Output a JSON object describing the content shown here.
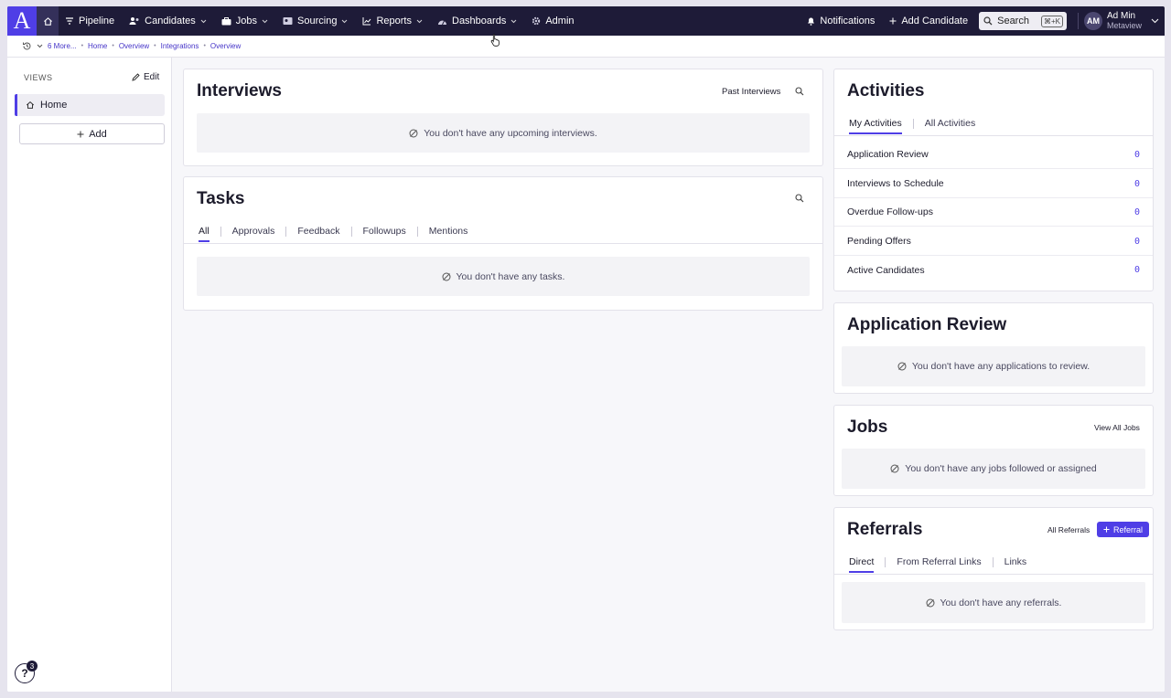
{
  "nav": {
    "logo_letter": "A",
    "items": [
      {
        "label": "Pipeline",
        "icon": "filter-icon",
        "dropdown": false
      },
      {
        "label": "Candidates",
        "icon": "people-icon",
        "dropdown": true
      },
      {
        "label": "Jobs",
        "icon": "briefcase-icon",
        "dropdown": true
      },
      {
        "label": "Sourcing",
        "icon": "sourcing-icon",
        "dropdown": true
      },
      {
        "label": "Reports",
        "icon": "chart-icon",
        "dropdown": true
      },
      {
        "label": "Dashboards",
        "icon": "gauge-icon",
        "dropdown": true
      },
      {
        "label": "Admin",
        "icon": "gear-icon",
        "dropdown": false
      }
    ],
    "notifications": "Notifications",
    "add_candidate": "Add Candidate",
    "search": "Search",
    "search_shortcut": "⌘+K",
    "user_initials": "AM",
    "user_name": "Ad Min",
    "user_org": "Metaview"
  },
  "breadcrumb": {
    "more": "6 More...",
    "items": [
      "Home",
      "Overview",
      "Integrations",
      "Overview"
    ]
  },
  "sidebar": {
    "views_label": "VIEWS",
    "edit": "Edit",
    "home": "Home",
    "add": "Add",
    "help_badge": "3"
  },
  "interviews": {
    "title": "Interviews",
    "past_link": "Past Interviews",
    "empty": "You don't have any upcoming interviews."
  },
  "tasks": {
    "title": "Tasks",
    "tabs": [
      "All",
      "Approvals",
      "Feedback",
      "Followups",
      "Mentions"
    ],
    "active_tab": 0,
    "empty": "You don't have any tasks."
  },
  "activities": {
    "title": "Activities",
    "tabs": [
      "My Activities",
      "All Activities"
    ],
    "rows": [
      {
        "label": "Application Review",
        "count": "0"
      },
      {
        "label": "Interviews to Schedule",
        "count": "0"
      },
      {
        "label": "Overdue Follow-ups",
        "count": "0"
      },
      {
        "label": "Pending Offers",
        "count": "0"
      },
      {
        "label": "Active Candidates",
        "count": "0"
      }
    ]
  },
  "application_review": {
    "title": "Application Review",
    "empty": "You don't have any applications to review."
  },
  "jobs": {
    "title": "Jobs",
    "view_all": "View All Jobs",
    "empty": "You don't have any jobs followed or assigned"
  },
  "referrals": {
    "title": "Referrals",
    "all_link": "All Referrals",
    "button": "Referral",
    "tabs": [
      "Direct",
      "From Referral Links",
      "Links"
    ],
    "empty": "You don't have any referrals."
  },
  "colors": {
    "nav_bg": "#1e1b38",
    "accent": "#4f3ee6",
    "page_bg": "#f7f7fa"
  }
}
